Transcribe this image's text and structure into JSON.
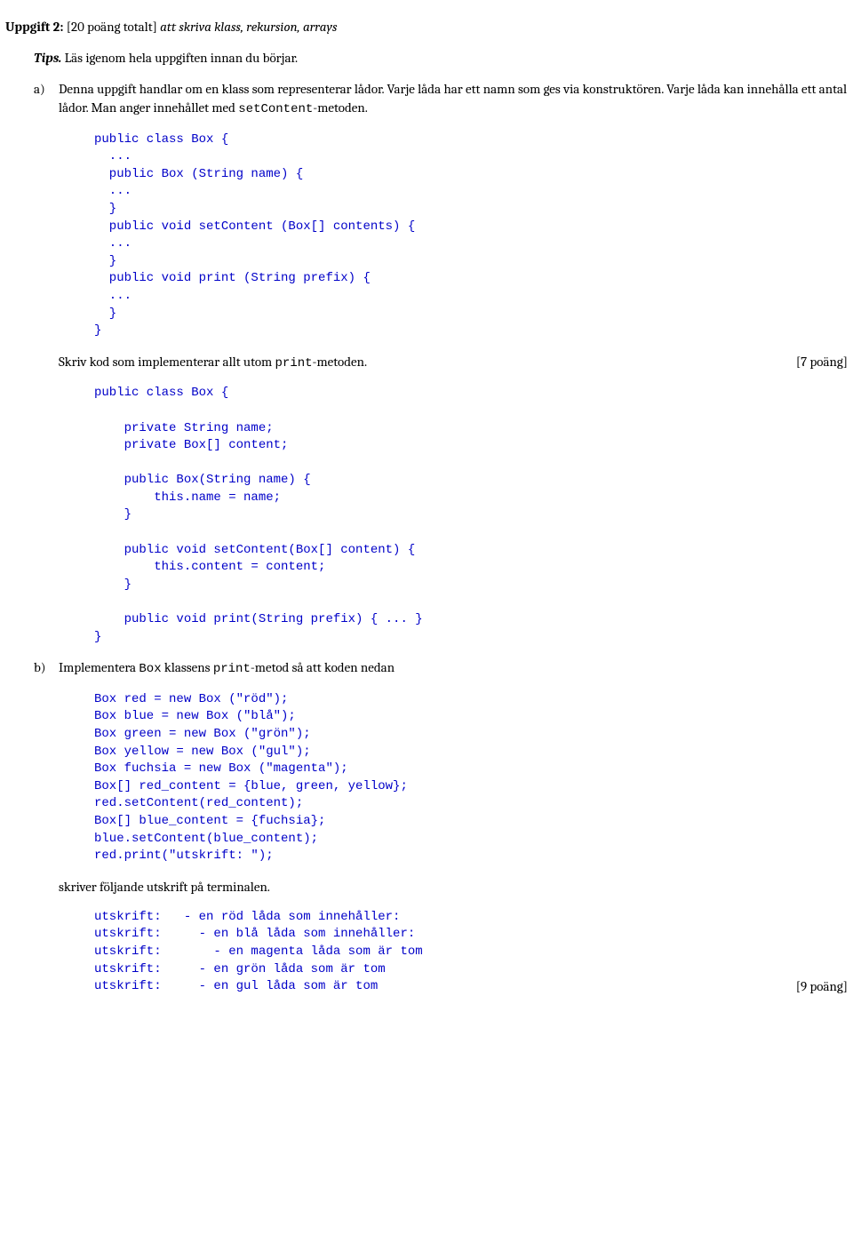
{
  "heading": {
    "title_prefix": "Uppgift 2:",
    "points": "[20 poäng totalt]",
    "topic": "att skriva klass, rekursion, arrays"
  },
  "tips": {
    "label": "Tips.",
    "text": "Läs igenom hela uppgiften innan du börjar."
  },
  "item_a": {
    "marker": "a)",
    "para_parts": {
      "p1": "Denna uppgift handlar om en klass som representerar lådor. Varje låda har ett namn som ges via konstruktören. Varje låda kan innehålla ett antal lådor. Man anger innehållet med ",
      "code1": "setContent",
      "p2": "-metoden."
    },
    "code1": "public class Box {\n  ...\n  public Box (String name) {\n  ...\n  }\n  public void setContent (Box[] contents) {\n  ...\n  }\n  public void print (String prefix) {\n  ...\n  }\n}",
    "skriv_parts": {
      "p1": "Skriv kod som implementerar allt utom ",
      "code1": "print",
      "p2": "-metoden."
    },
    "points_a": "[7 poäng]",
    "code2": "public class Box {\n\n    private String name;\n    private Box[] content;\n\n    public Box(String name) {\n        this.name = name;\n    }\n\n    public void setContent(Box[] content) {\n        this.content = content;\n    }\n\n    public void print(String prefix) { ... }\n}"
  },
  "item_b": {
    "marker": "b)",
    "para_parts": {
      "p1": "Implementera ",
      "code1": "Box",
      "p2": " klassens ",
      "code2": "print",
      "p3": "-metod så att koden nedan"
    },
    "code1": "Box red = new Box (\"röd\");\nBox blue = new Box (\"blå\");\nBox green = new Box (\"grön\");\nBox yellow = new Box (\"gul\");\nBox fuchsia = new Box (\"magenta\");\nBox[] red_content = {blue, green, yellow};\nred.setContent(red_content);\nBox[] blue_content = {fuchsia};\nblue.setContent(blue_content);\nred.print(\"utskrift: \");",
    "mid_text": "skriver följande utskrift på terminalen.",
    "code2": "utskrift:   - en röd låda som innehåller:\nutskrift:     - en blå låda som innehåller:\nutskrift:       - en magenta låda som är tom\nutskrift:     - en grön låda som är tom\nutskrift:     - en gul låda som är tom",
    "points_b": "[9 poäng]"
  }
}
